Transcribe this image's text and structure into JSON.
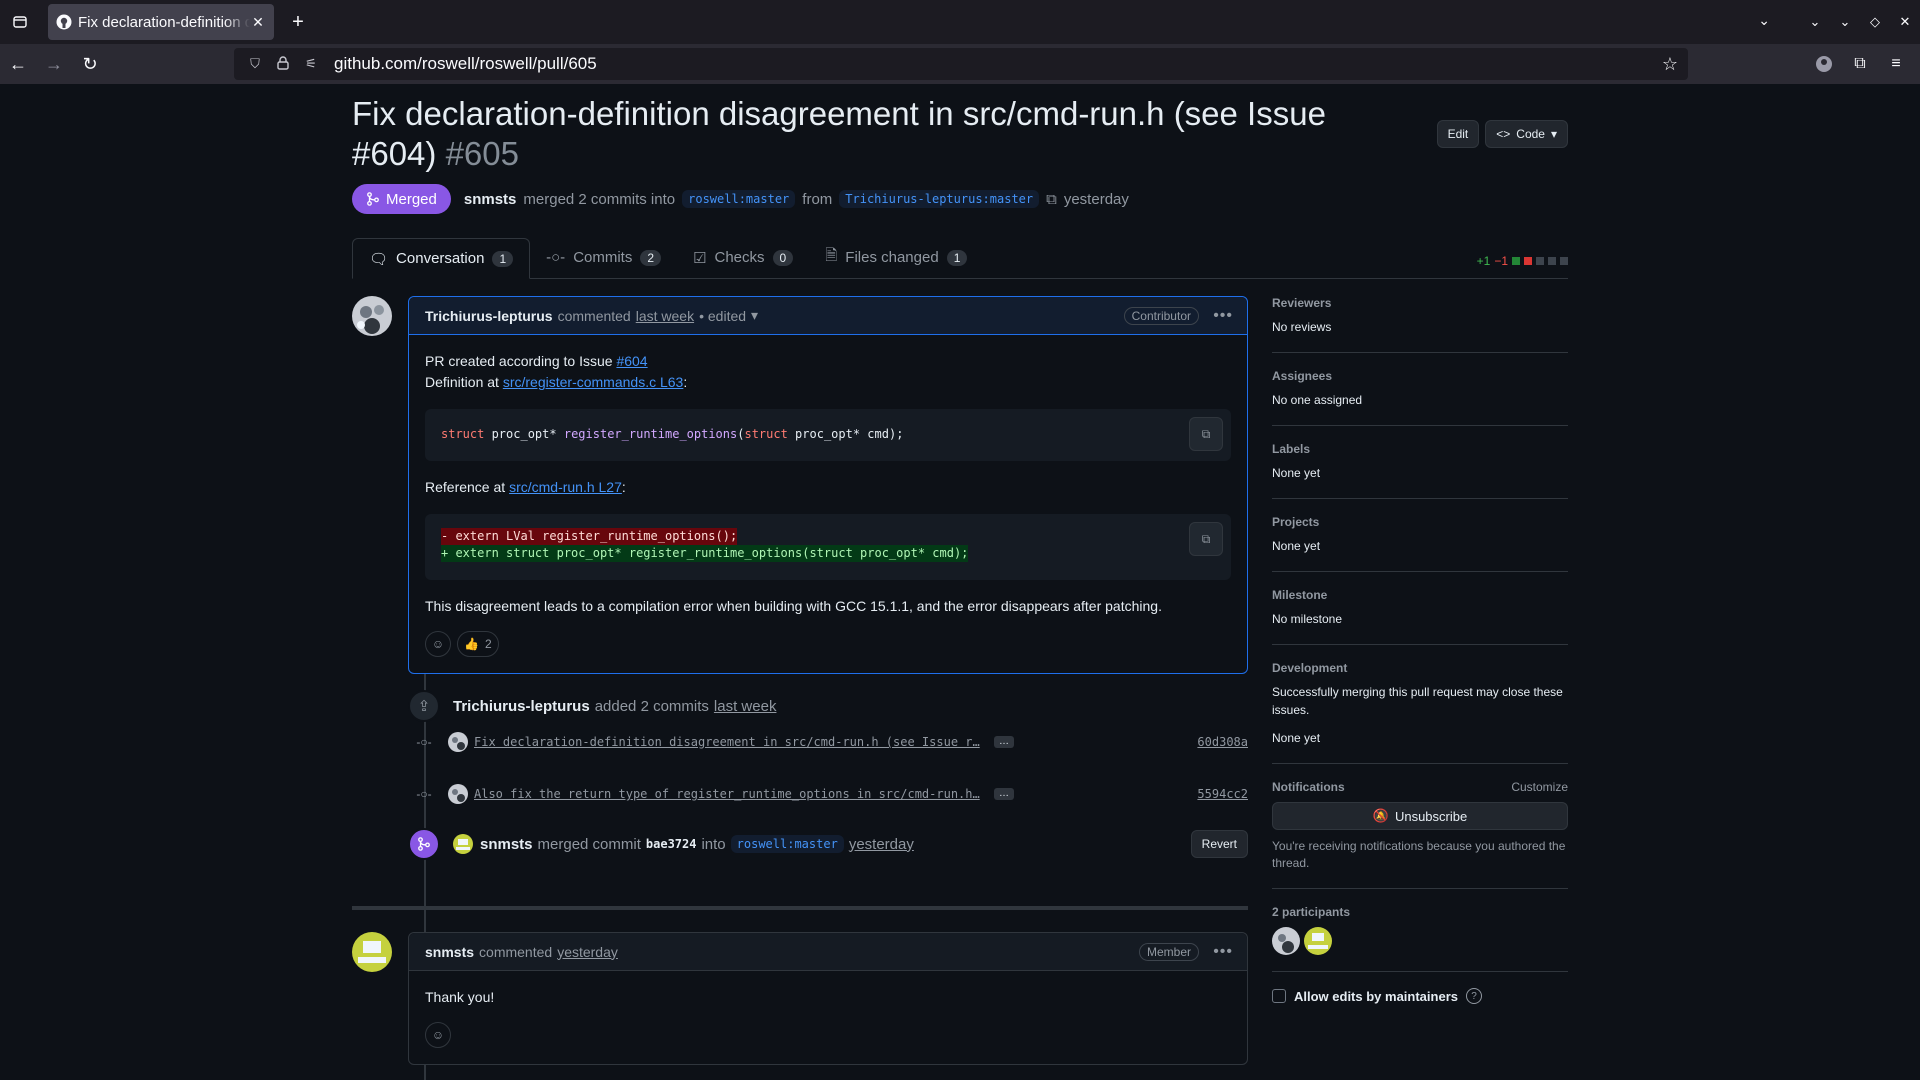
{
  "browser": {
    "tab_title": "Fix declaration-definition disagreement in src/cmd-run.h",
    "url": "github.com/roswell/roswell/pull/605"
  },
  "pr": {
    "title": "Fix declaration-definition disagreement in src/cmd-run.h (see Issue #604)",
    "number": "#605",
    "state": "Merged",
    "author": "snmsts",
    "merged_text": "merged 2 commits into",
    "base_branch": "roswell:master",
    "from_text": "from",
    "head_branch": "Trichiurus-lepturus:master",
    "time": "yesterday",
    "edit_label": "Edit",
    "code_label": "Code"
  },
  "tabs": [
    {
      "label": "Conversation",
      "count": "1"
    },
    {
      "label": "Commits",
      "count": "2"
    },
    {
      "label": "Checks",
      "count": "0"
    },
    {
      "label": "Files changed",
      "count": "1"
    }
  ],
  "diffstat": {
    "additions": "+1",
    "deletions": "−1"
  },
  "comment1": {
    "author": "Trichiurus-lepturus",
    "action": "commented",
    "time": "last week",
    "edited": "• edited",
    "role": "Contributor",
    "line1_prefix": "PR created according to Issue",
    "line1_link": "#604",
    "line2_prefix": "Definition at",
    "line2_link": "src/register-commands.c L63",
    "code1": {
      "kw1": "struct",
      "t1": " proc_opt* ",
      "fn": "register_runtime_options",
      "t2": "(",
      "kw2": "struct",
      "t3": " proc_opt* cmd);"
    },
    "ref_prefix": "Reference at",
    "ref_link": "src/cmd-run.h L27",
    "diff_del": "- extern LVal register_runtime_options();",
    "diff_add": "+ extern struct proc_opt* register_runtime_options(struct proc_opt* cmd);",
    "closing": "This disagreement leads to a compilation error when building with GCC 15.1.1, and the error disappears after patching.",
    "thumbs_count": "2"
  },
  "commits_event": {
    "author": "Trichiurus-lepturus",
    "action": "added 2 commits",
    "time": "last week",
    "commits": [
      {
        "message": "Fix declaration-definition disagreement in src/cmd-run.h (see Issue r…",
        "sha": "60d308a"
      },
      {
        "message": "Also fix the return type of register_runtime_options in src/cmd-run.h…",
        "sha": "5594cc2"
      }
    ]
  },
  "merge_event": {
    "author": "snmsts",
    "action": "merged commit",
    "commit": "bae3724",
    "into": "into",
    "branch": "roswell:master",
    "time": "yesterday",
    "revert_label": "Revert"
  },
  "comment2": {
    "author": "snmsts",
    "action": "commented",
    "time": "yesterday",
    "role": "Member",
    "body": "Thank you!"
  },
  "sidebar": {
    "reviewers": {
      "title": "Reviewers",
      "value": "No reviews"
    },
    "assignees": {
      "title": "Assignees",
      "value": "No one assigned"
    },
    "labels": {
      "title": "Labels",
      "value": "None yet"
    },
    "projects": {
      "title": "Projects",
      "value": "None yet"
    },
    "milestone": {
      "title": "Milestone",
      "value": "No milestone"
    },
    "development": {
      "title": "Development",
      "note": "Successfully merging this pull request may close these issues.",
      "value": "None yet"
    },
    "notifications": {
      "title": "Notifications",
      "customize": "Customize",
      "unsubscribe": "Unsubscribe",
      "note": "You're receiving notifications because you authored the thread."
    },
    "participants": {
      "title": "2 participants"
    },
    "allow_edits": "Allow edits by maintainers"
  }
}
